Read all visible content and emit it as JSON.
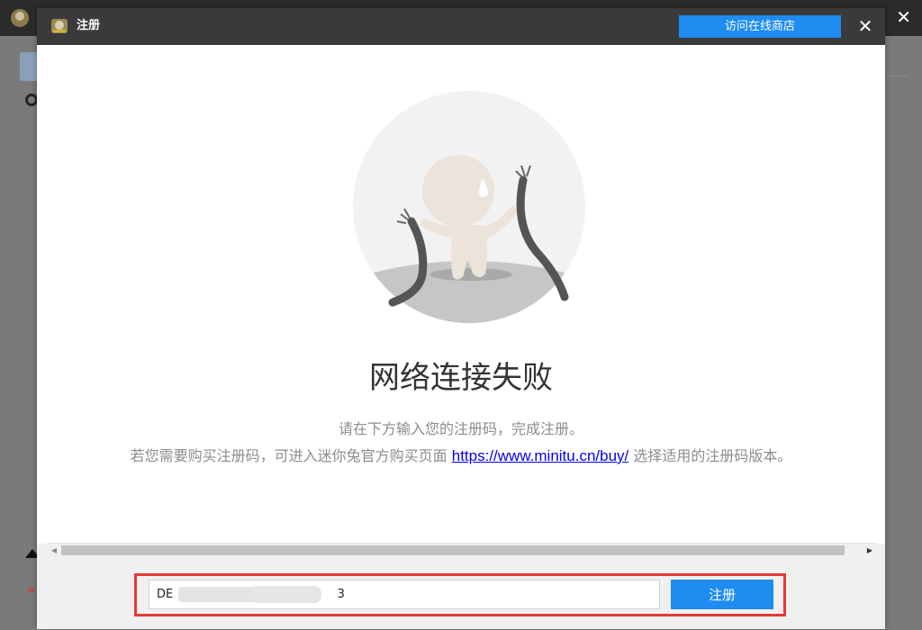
{
  "background_app": {
    "close_glyph": "✕",
    "side_glyph": "»"
  },
  "dialog": {
    "title": "注册",
    "store_button_label": "访问在线商店",
    "close_glyph": "✕"
  },
  "content": {
    "error_title": "网络连接失败",
    "info_line1": "请在下方输入您的注册码，完成注册。",
    "info_line2_prefix": "若您需要购买注册码，可进入迷你兔官方购买页面 ",
    "info_line2_link": "https://www.minitu.cn/buy/",
    "info_line2_suffix": " 选择适用的注册码版本。"
  },
  "scrollbar": {
    "left_arrow": "◀",
    "right_arrow": "▶"
  },
  "registration": {
    "code_value": "DE                    -42                   3",
    "register_button_label": "注册"
  },
  "colors": {
    "accent": "#1e8cf0",
    "highlight_frame": "#e53935",
    "titlebar": "#3a3a3a",
    "link": "#0000ee"
  }
}
